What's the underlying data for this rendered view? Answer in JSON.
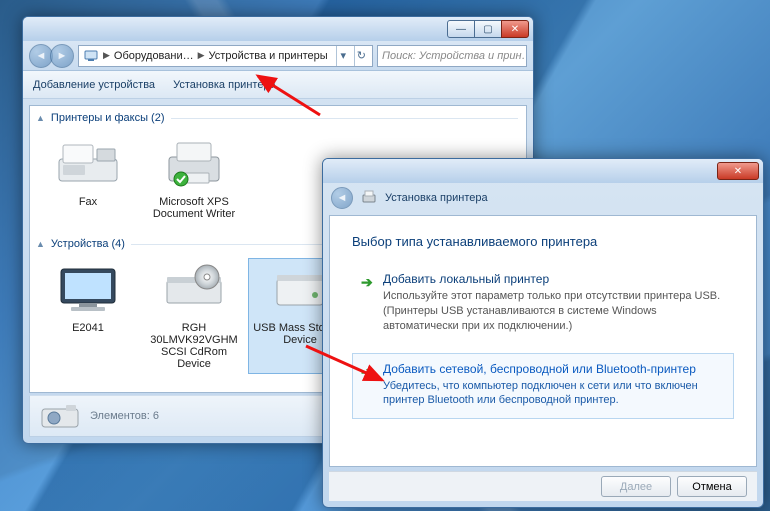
{
  "explorer": {
    "breadcrumb": {
      "seg1": "Оборудовани…",
      "seg2": "Устройства и принтеры"
    },
    "search_placeholder": "Поиск: Устройства и прин…",
    "toolbar": {
      "add_device": "Добавление устройства",
      "add_printer": "Установка принтера"
    },
    "groups": [
      {
        "title": "Принтеры и факсы (2)"
      },
      {
        "title": "Устройства (4)"
      }
    ],
    "printers": [
      {
        "label": "Fax"
      },
      {
        "label": "Microsoft XPS Document Writer"
      }
    ],
    "devices": [
      {
        "label": "E2041"
      },
      {
        "label": "RGH 30LMVK92VGHM SCSI CdRom Device"
      },
      {
        "label": "USB Mass Storage Device"
      }
    ],
    "status": {
      "heading": "Элементов: 6"
    }
  },
  "dialog": {
    "title": "Установка принтера",
    "heading": "Выбор типа устанавливаемого принтера",
    "options": [
      {
        "title": "Добавить локальный принтер",
        "desc": "Используйте этот параметр только при отсутствии принтера USB. (Принтеры USB устанавливаются в системе Windows автоматически при их подключении.)"
      },
      {
        "title": "Добавить сетевой, беспроводной или Bluetooth-принтер",
        "desc": "Убедитесь, что компьютер подключен к сети или что включен принтер Bluetooth или беспроводной принтер."
      }
    ],
    "buttons": {
      "next": "Далее",
      "cancel": "Отмена"
    }
  }
}
